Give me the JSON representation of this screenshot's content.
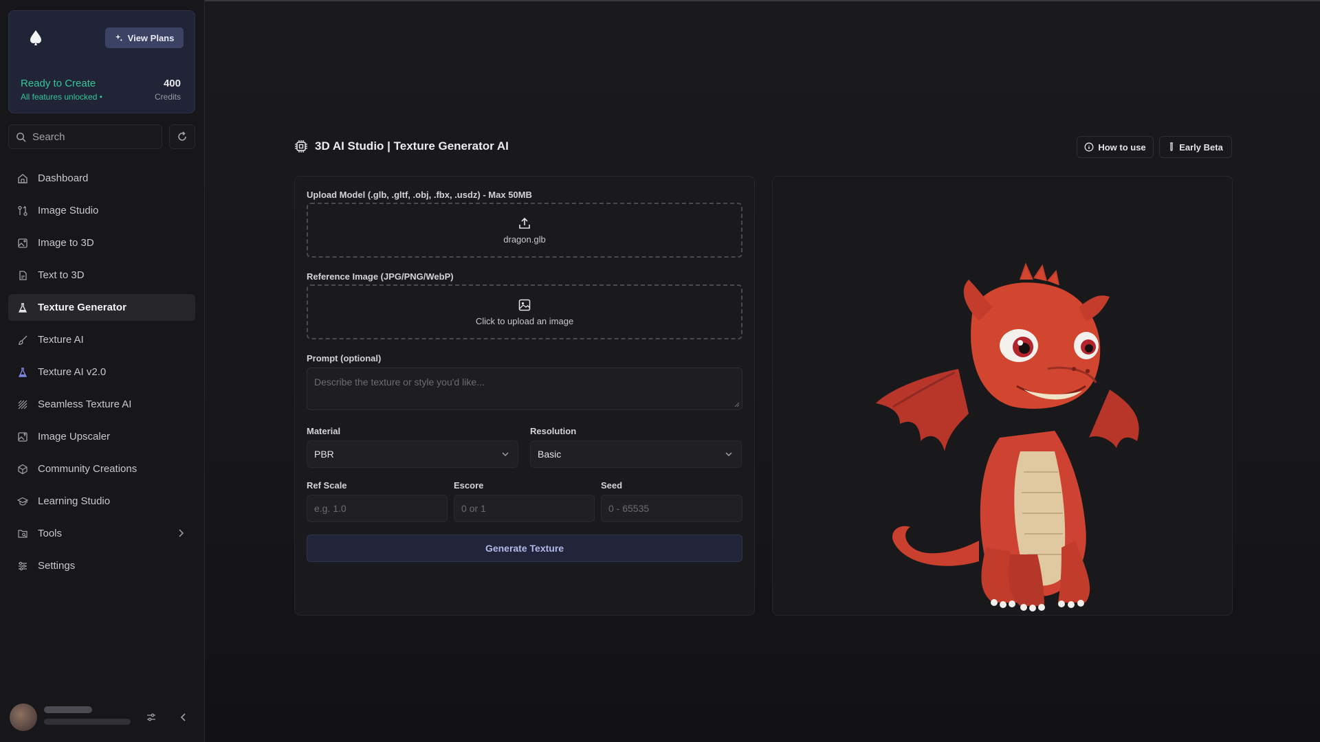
{
  "sidebar": {
    "plan": {
      "view_plans": "View Plans",
      "ready": "Ready to Create",
      "unlocked": "All features unlocked •",
      "credits_value": "400",
      "credits_label": "Credits"
    },
    "search_placeholder": "Search",
    "items": [
      {
        "label": "Dashboard",
        "icon": "home-icon"
      },
      {
        "label": "Image Studio",
        "icon": "git-compare-icon"
      },
      {
        "label": "Image to 3D",
        "icon": "image-plus-icon"
      },
      {
        "label": "Text to 3D",
        "icon": "file-icon"
      },
      {
        "label": "Texture Generator",
        "icon": "flask-icon",
        "active": true
      },
      {
        "label": "Texture AI",
        "icon": "paintbrush-icon"
      },
      {
        "label": "Texture AI v2.0",
        "icon": "flask-icon"
      },
      {
        "label": "Seamless Texture AI",
        "icon": "hatch-icon"
      },
      {
        "label": "Image Upscaler",
        "icon": "image-up-icon"
      },
      {
        "label": "Community Creations",
        "icon": "box-icon"
      },
      {
        "label": "Learning Studio",
        "icon": "graduation-cap-icon"
      },
      {
        "label": "Tools",
        "icon": "folder-search-icon"
      },
      {
        "label": "Settings",
        "icon": "sliders-icon"
      }
    ]
  },
  "header": {
    "title": "3D AI Studio | Texture Generator AI",
    "how_to_use": "How to use",
    "early_beta": "Early Beta"
  },
  "form": {
    "upload_model_label": "Upload Model (.glb, .gltf, .obj, .fbx, .usdz) - Max 50MB",
    "upload_model_file": "dragon.glb",
    "reference_label": "Reference Image (JPG/PNG/WebP)",
    "reference_hint": "Click to upload an image",
    "prompt_label": "Prompt (optional)",
    "prompt_placeholder": "Describe the texture or style you'd like...",
    "material_label": "Material",
    "material_value": "PBR",
    "resolution_label": "Resolution",
    "resolution_value": "Basic",
    "ref_scale_label": "Ref Scale",
    "ref_scale_placeholder": "e.g. 1.0",
    "escore_label": "Escore",
    "escore_placeholder": "0 or 1",
    "seed_label": "Seed",
    "seed_placeholder": "0 - 65535",
    "generate_label": "Generate Texture"
  },
  "colors": {
    "accent_green": "#34c79a",
    "generate_text": "#b3b9ea",
    "dragon_red": "#d2452e"
  }
}
